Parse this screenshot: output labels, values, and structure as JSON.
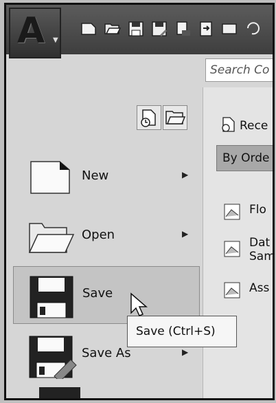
{
  "search": {
    "placeholder": "Search Co"
  },
  "view_buttons": {
    "recent_icon": "recent-documents-icon",
    "open_icon": "open-documents-icon"
  },
  "menu": {
    "items": [
      {
        "label": "New",
        "icon": "new-document-icon"
      },
      {
        "label": "Open",
        "icon": "open-folder-icon"
      },
      {
        "label": "Save",
        "icon": "save-disk-icon"
      },
      {
        "label": "Save As",
        "icon": "save-as-disk-icon"
      }
    ]
  },
  "tooltip": {
    "text": "Save (Ctrl+S)"
  },
  "recent": {
    "header": "Rece",
    "order_by": "By Orde",
    "files": [
      {
        "line1": "Flo"
      },
      {
        "line1": "Dat",
        "line2": "Sam"
      },
      {
        "line1": "Ass"
      }
    ]
  },
  "colors": {
    "titlebar": "#4a4a4a",
    "menu_bg": "#d6d6d6",
    "selected": "#c4c4c4"
  }
}
